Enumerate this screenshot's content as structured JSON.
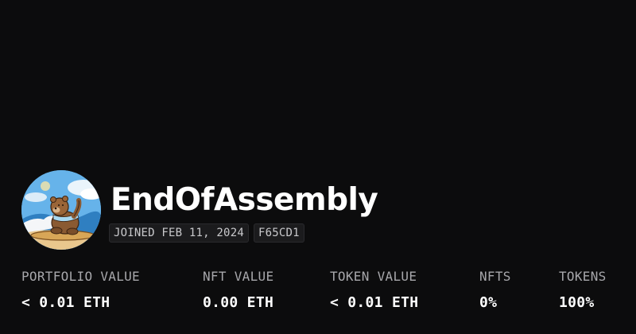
{
  "profile": {
    "username": "EndOfAssembly",
    "avatar_icon": "bear-on-surfboard-avatar",
    "joined": "JOINED FEB 11, 2024",
    "tag": "F65CD1"
  },
  "stats": [
    {
      "label": "PORTFOLIO VALUE",
      "value": "< 0.01 ETH"
    },
    {
      "label": "NFT VALUE",
      "value": "0.00 ETH"
    },
    {
      "label": "TOKEN VALUE",
      "value": "< 0.01 ETH"
    },
    {
      "label": "NFTS",
      "value": "0%"
    },
    {
      "label": "TOKENS",
      "value": "100%"
    }
  ],
  "colors": {
    "background": "#0c0c0d",
    "text": "#ffffff",
    "muted": "#a7a7ab",
    "chip_bg": "#1b1b1d"
  }
}
